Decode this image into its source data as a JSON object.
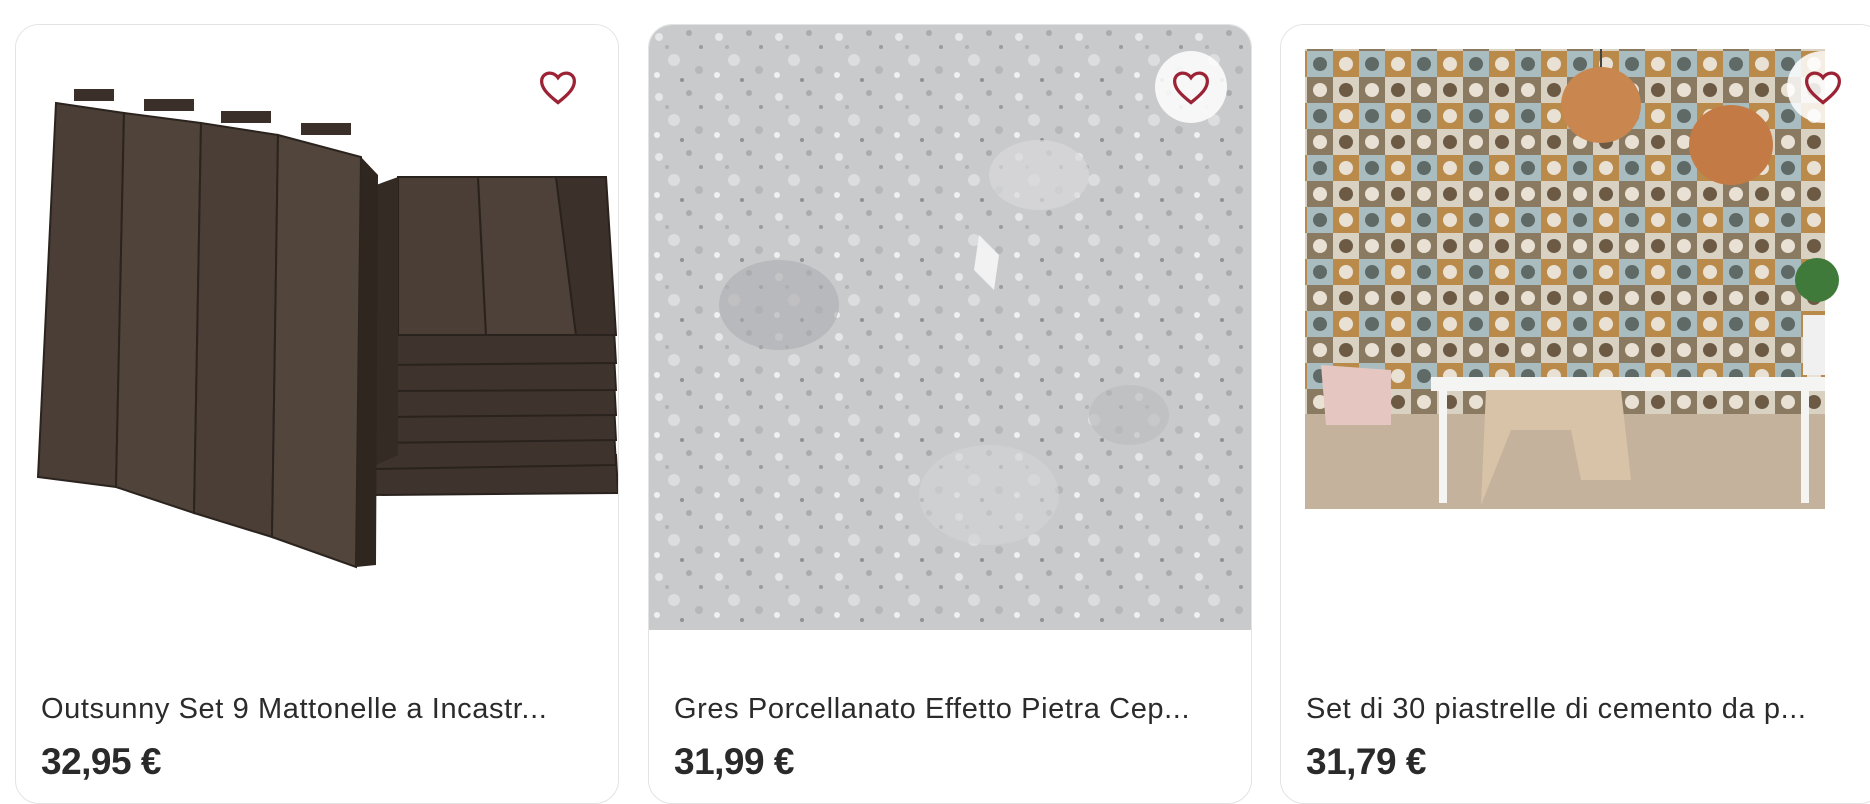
{
  "products": [
    {
      "title": "Outsunny Set 9 Mattonelle a Incastr...",
      "price": "32,95 €",
      "favorite_icon": "heart-outline-icon",
      "image": "dark-brown-interlocking-deck-tiles"
    },
    {
      "title": "Gres Porcellanato Effetto Pietra Cep...",
      "price": "31,99 €",
      "favorite_icon": "heart-outline-icon",
      "image": "grey-terrazzo-stone-tile"
    },
    {
      "title": "Set di 30 piastrelle di cemento da p...",
      "price": "31,79 €",
      "favorite_icon": "heart-outline-icon",
      "image": "patterned-cement-tile-wall-dining-room"
    }
  ],
  "colors": {
    "heart": "#9b2335",
    "card_border": "#e3e3e3"
  }
}
